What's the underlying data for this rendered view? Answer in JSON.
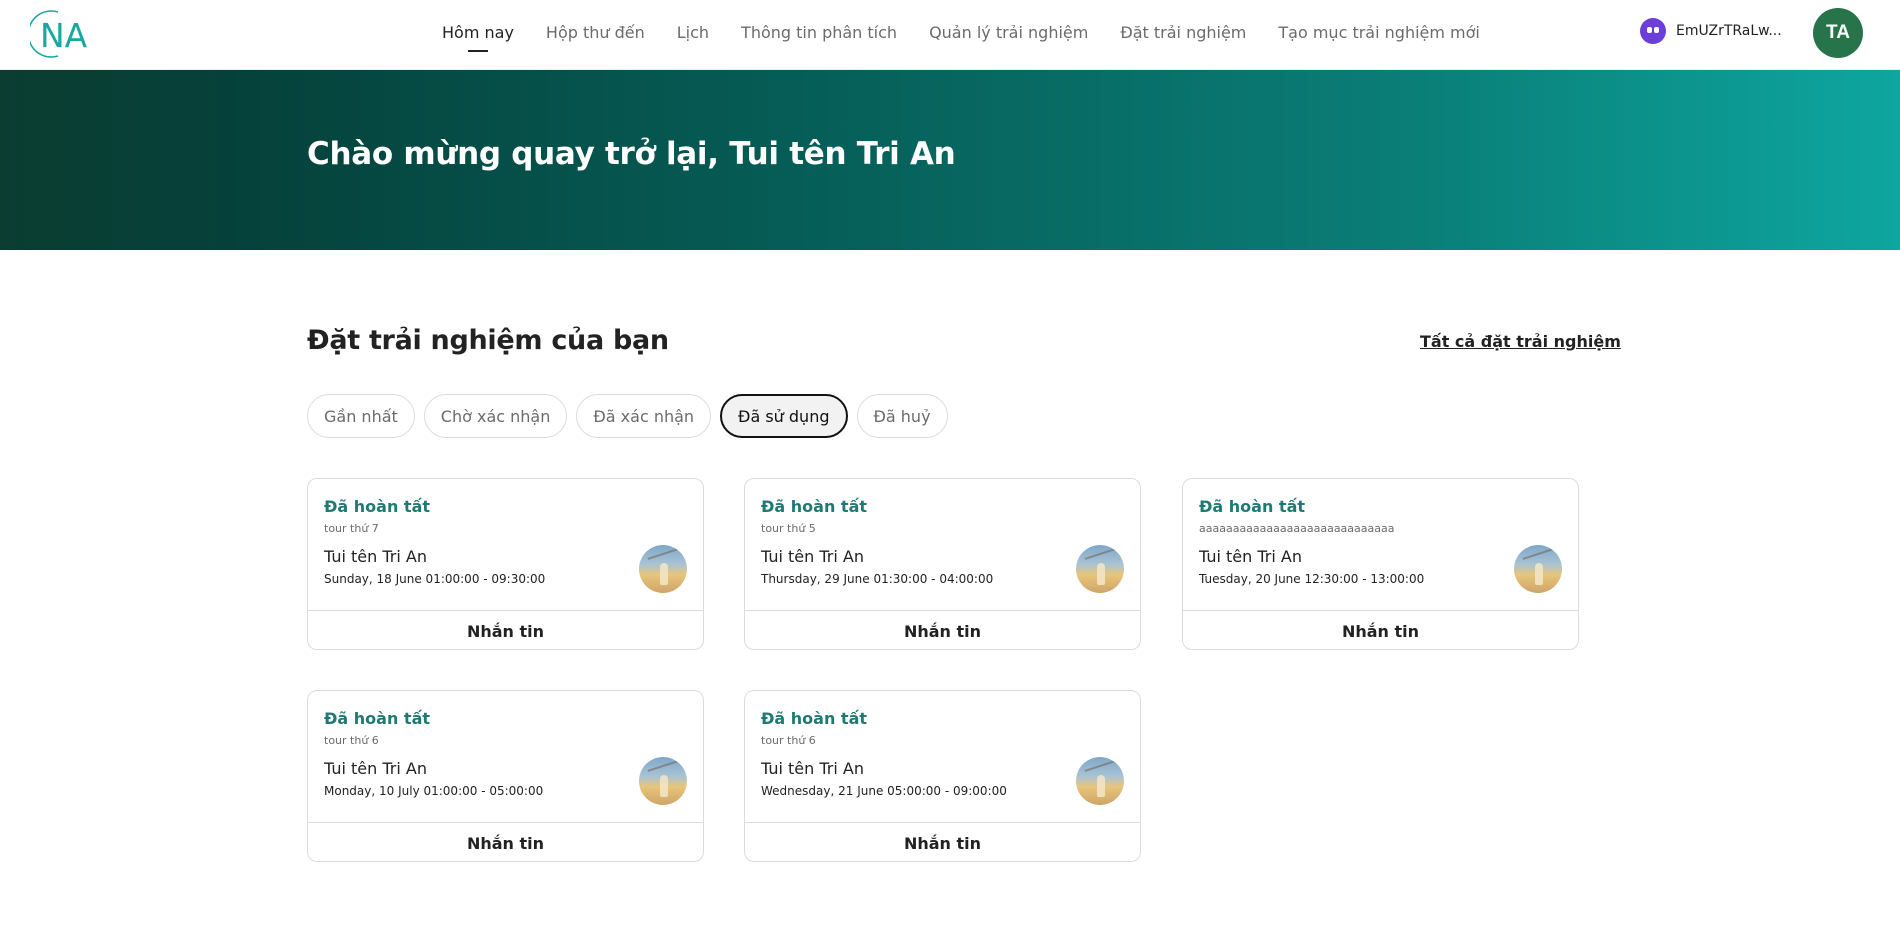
{
  "header": {
    "logo_text": "NA",
    "nav": [
      {
        "label": "Hôm nay",
        "active": true
      },
      {
        "label": "Hộp thư đến",
        "active": false
      },
      {
        "label": "Lịch",
        "active": false
      },
      {
        "label": "Thông tin phân tích",
        "active": false
      },
      {
        "label": "Quản lý trải nghiệm",
        "active": false
      },
      {
        "label": "Đặt trải nghiệm",
        "active": false
      },
      {
        "label": "Tạo mục trải nghiệm mới",
        "active": false
      }
    ],
    "wallet_label": "EmUZrTRaLw...",
    "avatar_initials": "TA"
  },
  "hero": {
    "title": "Chào mừng quay trở lại, Tui tên Tri An"
  },
  "bookings": {
    "title": "Đặt trải nghiệm của bạn",
    "all_link": "Tất cả đặt trải nghiệm",
    "filters": [
      {
        "label": "Gần nhất",
        "active": false
      },
      {
        "label": "Chờ xác nhận",
        "active": false
      },
      {
        "label": "Đã xác nhận",
        "active": false
      },
      {
        "label": "Đã sử dụng",
        "active": true
      },
      {
        "label": "Đã huỷ",
        "active": false
      }
    ],
    "cards": [
      {
        "status": "Đã hoàn tất",
        "tour": "tour thứ 7",
        "host": "Tui tên Tri An",
        "time": "Sunday, 18 June 01:00:00 - 09:30:00",
        "button": "Nhắn tin"
      },
      {
        "status": "Đã hoàn tất",
        "tour": "tour thứ 5",
        "host": "Tui tên Tri An",
        "time": "Thursday, 29 June 01:30:00 - 04:00:00",
        "button": "Nhắn tin"
      },
      {
        "status": "Đã hoàn tất",
        "tour": "aaaaaaaaaaaaaaaaaaaaaaaaaaaaa",
        "host": "Tui tên Tri An",
        "time": "Tuesday, 20 June 12:30:00 - 13:00:00",
        "button": "Nhắn tin"
      },
      {
        "status": "Đã hoàn tất",
        "tour": "tour thứ 6",
        "host": "Tui tên Tri An",
        "time": "Monday, 10 July 01:00:00 - 05:00:00",
        "button": "Nhắn tin"
      },
      {
        "status": "Đã hoàn tất",
        "tour": "tour thứ 6",
        "host": "Tui tên Tri An",
        "time": "Wednesday, 21 June 05:00:00 - 09:00:00",
        "button": "Nhắn tin"
      }
    ]
  },
  "colors": {
    "accent": "#1f7a73",
    "avatar_bg": "#27744a",
    "hero_start": "#0b3d31",
    "hero_end": "#0ea6a0"
  }
}
